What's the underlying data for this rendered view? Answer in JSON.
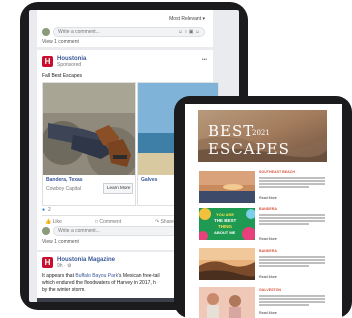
{
  "facebook": {
    "sort_label": "Most Relevant ▾",
    "comment_placeholder": "Write a comment...",
    "view_comment": "View 1 comment",
    "page_name": "Houstonia",
    "sponsored": "Sponsored",
    "post_text": "Fall Best Escapes",
    "carousel": [
      {
        "title": "Bandera, Texas",
        "subtitle": "Cowboy Capital",
        "cta": "Learn More"
      },
      {
        "title": "Galves",
        "subtitle": "",
        "cta": ""
      }
    ],
    "reaction_count": "2",
    "actions": {
      "like": "Like",
      "comment": "Comment",
      "share": "Share"
    },
    "comment_placeholder_2": "Write a comment...",
    "view_comment_2": "View 1 comment",
    "post2": {
      "page_name": "Houstonia Magazine",
      "meta": "9h · ⚙",
      "text_1_before": "It appears that ",
      "text_1_link": "Buffalo Bayou Park",
      "text_1_after": "'s Mexican free-tail",
      "text_2": "which endured the floodwaters of Harvey in 2017, h",
      "text_3": "by the winter storm."
    }
  },
  "newsletter": {
    "hero_title": "BEST",
    "hero_year": "2021",
    "hero_subtitle": "ESCAPES",
    "rows": [
      {
        "title": "SOUTHEAST BEACH",
        "read_more": "Read More"
      },
      {
        "title": "BANDERA",
        "read_more": "Read More",
        "image_text": [
          "YOU ARE",
          "THE BEST",
          "THING",
          "ABOUT ME"
        ]
      },
      {
        "title": "BANDERA",
        "read_more": "Read More"
      },
      {
        "title": "GALVESTON",
        "read_more": "Read More"
      }
    ]
  }
}
